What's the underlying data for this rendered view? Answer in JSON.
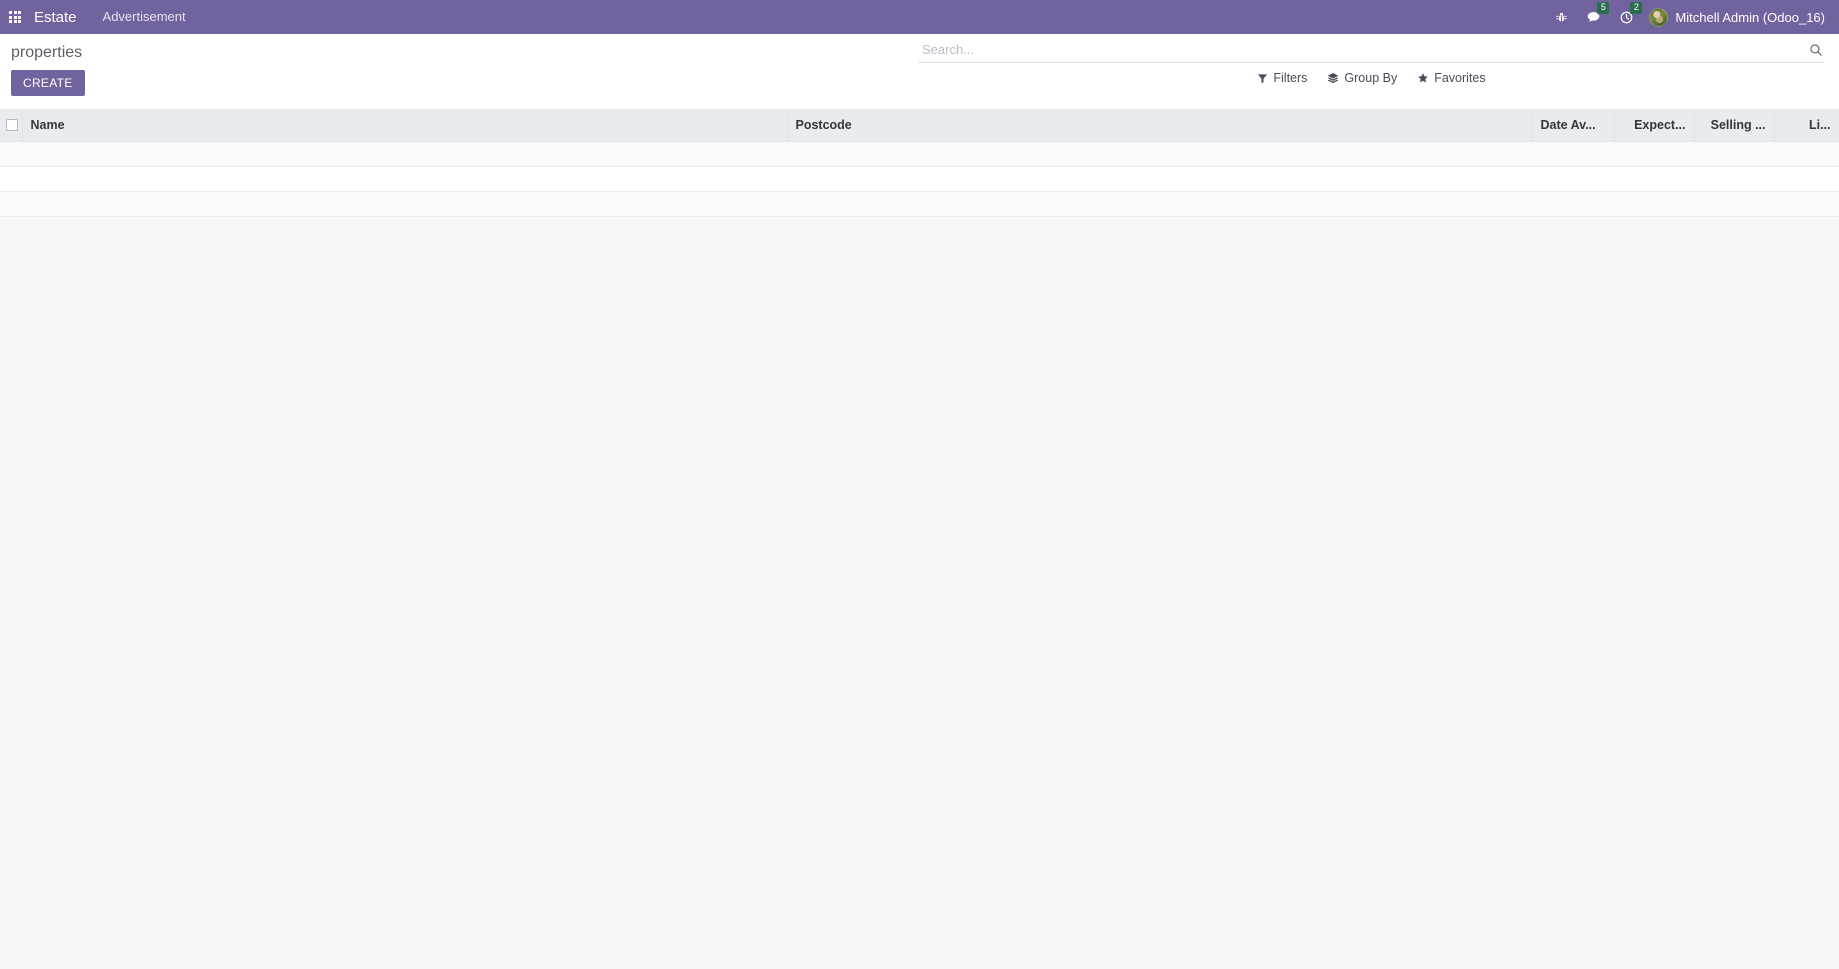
{
  "navbar": {
    "apps_icon": "apps-grid-icon",
    "brand": "Estate",
    "menu_items": [
      {
        "label": "Advertisement",
        "name": "nav-menu-advertisement"
      }
    ],
    "system_icons": [
      {
        "name": "bug-icon",
        "badge": null
      },
      {
        "name": "messages-icon",
        "badge": "5"
      },
      {
        "name": "activities-clock-icon",
        "badge": "2"
      }
    ],
    "user": {
      "name": "Mitchell Admin (Odoo_16)",
      "avatar_name": "user-avatar"
    }
  },
  "control_panel": {
    "breadcrumb": "properties",
    "create_label": "CREATE",
    "search": {
      "placeholder": "Search...",
      "value": "",
      "icon": "search-icon"
    },
    "tools": [
      {
        "label": "Filters",
        "icon": "filter-funnel-icon",
        "name": "filters-button"
      },
      {
        "label": "Group By",
        "icon": "layers-icon",
        "name": "group-by-button"
      },
      {
        "label": "Favorites",
        "icon": "star-icon",
        "name": "favorites-button"
      }
    ]
  },
  "list_view": {
    "select_all_checkbox": "select-all-checkbox",
    "columns": [
      {
        "label": "Name",
        "align": "left"
      },
      {
        "label": "Postcode",
        "align": "left"
      },
      {
        "label": "Date Av...",
        "align": "left"
      },
      {
        "label": "Expect...",
        "align": "right"
      },
      {
        "label": "Selling ...",
        "align": "right"
      },
      {
        "label": "Li...",
        "align": "right"
      }
    ],
    "rows": [
      {
        "cells": [
          "",
          "",
          "",
          "",
          "",
          ""
        ]
      },
      {
        "cells": [
          "",
          "",
          "",
          "",
          "",
          ""
        ]
      },
      {
        "cells": [
          "",
          "",
          "",
          "",
          "",
          ""
        ]
      }
    ]
  },
  "colors": {
    "brand_purple": "#71639e",
    "badge_green": "#2b6e4f",
    "header_gray": "#e9ecef",
    "page_bg": "#f6f7f9"
  }
}
